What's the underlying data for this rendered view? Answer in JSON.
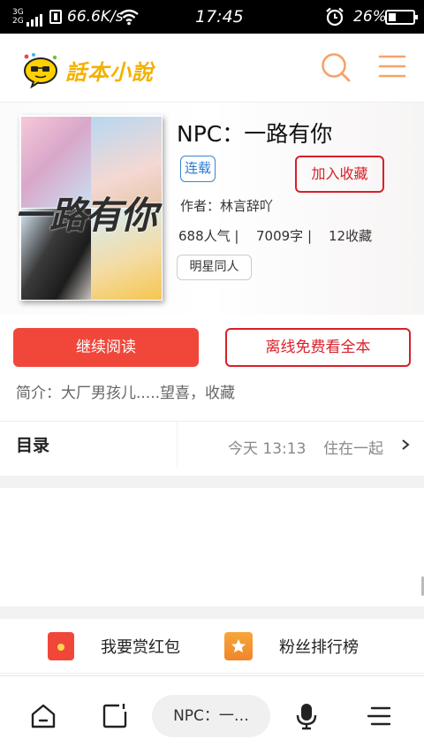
{
  "status_bar": {
    "network_top": "3G",
    "network_bottom": "2G",
    "speed": "66.6K/s",
    "time": "17:45",
    "battery": "26%"
  },
  "header": {
    "logo_text": "話本小說",
    "icons": [
      "search-icon",
      "menu-icon"
    ]
  },
  "book": {
    "title": "NPC：一路有你",
    "cover_text": "一路有你",
    "status_tag": "连载",
    "favorite_button": "加入收藏",
    "author": "作者：林言辞吖",
    "popularity": "688人气 |",
    "word_count": "7009字 |",
    "favorites": "12收藏",
    "genre_tag": "明星同人"
  },
  "actions": {
    "continue_reading": "继续阅读",
    "offline_free": "离线免费看全本"
  },
  "intro": "简介：大厂男孩儿.....望喜，收藏",
  "toc": {
    "label": "目录",
    "updated": "今天 13:13",
    "latest_chapter": "住在一起"
  },
  "rewards": {
    "red_packet": "我要赏红包",
    "fan_ranking": "粉丝排行榜"
  },
  "bottom_bar": {
    "url_text": "NPC：一…",
    "icons": [
      "home-icon",
      "tabs-icon",
      "mic-icon",
      "menu-icon"
    ]
  },
  "colors": {
    "accent_red": "#d8202a",
    "button_red": "#f1473b",
    "logo_yellow": "#f2b100",
    "header_icon_orange": "#f5a36a",
    "tag_blue": "#3a86d0"
  }
}
